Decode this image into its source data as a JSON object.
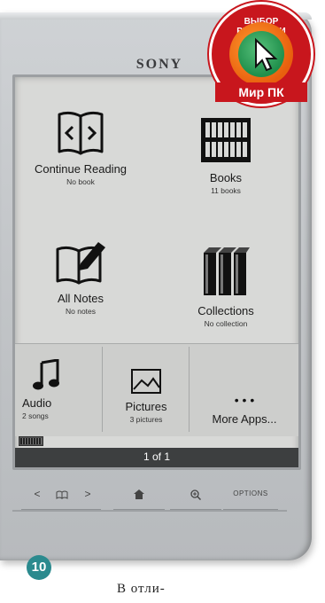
{
  "device": {
    "brand": "SONY"
  },
  "home": {
    "continue_reading": {
      "title": "Continue Reading",
      "sub": "No book",
      "icon": "open-book-arrows-icon"
    },
    "books": {
      "title": "Books",
      "sub": "11 books",
      "icon": "bookshelf-icon"
    },
    "all_notes": {
      "title": "All Notes",
      "sub": "No notes",
      "icon": "book-pen-icon"
    },
    "collections": {
      "title": "Collections",
      "sub": "No collection",
      "icon": "book-stack-icon"
    },
    "audio": {
      "title": "Audio",
      "sub": "2 songs",
      "icon": "music-note-icon"
    },
    "pictures": {
      "title": "Pictures",
      "sub": "3 pictures",
      "icon": "picture-icon"
    },
    "more_apps": {
      "title": "More Apps...",
      "icon": "dots-icon",
      "dots": "• • •"
    }
  },
  "page_indicator": "1 of 1",
  "hardware_buttons": {
    "prev": "<",
    "next": ">",
    "options": "OPTIONS"
  },
  "badge": {
    "top_text": "ВЫБОР РЕДАКЦИИ",
    "bottom_text": "Мир ПК"
  },
  "article": {
    "number": "10",
    "text": "В отли-"
  },
  "colors": {
    "badge_red": "#c8161d",
    "badge_orange": "#e85f0e",
    "badge_green": "#1f8f4b",
    "number_teal": "#2b8a8e"
  }
}
